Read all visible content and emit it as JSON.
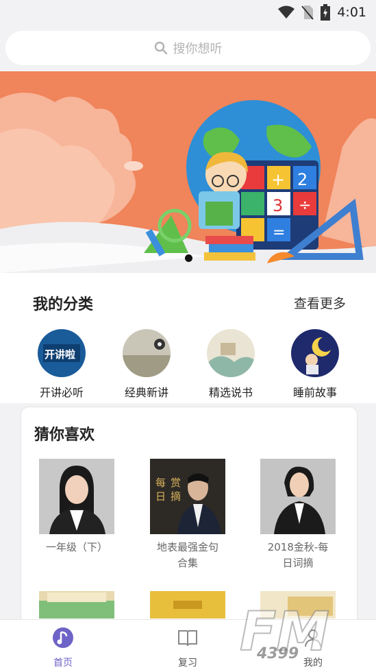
{
  "status": {
    "time": "4:01",
    "icons": [
      "wifi-icon",
      "no-sim-icon",
      "battery-charging-icon"
    ]
  },
  "search": {
    "placeholder": "搜你想听",
    "icon": "search-icon"
  },
  "banner": {
    "active_index": 0,
    "dots": 1
  },
  "categories": {
    "title": "我的分类",
    "more": "查看更多",
    "items": [
      {
        "label": "开讲必听",
        "icon": "kaijiang-thumb"
      },
      {
        "label": "经典新讲",
        "icon": "classic-thumb"
      },
      {
        "label": "精选说书",
        "icon": "storybook-thumb"
      },
      {
        "label": "睡前故事",
        "icon": "bedtime-thumb"
      }
    ]
  },
  "recommend": {
    "title": "猜你喜欢",
    "items": [
      {
        "line1": "一年级（下）",
        "line2": ""
      },
      {
        "line1": "地表最强金句",
        "line2": "合集"
      },
      {
        "line1": "2018金秋-每",
        "line2": "日词摘"
      }
    ],
    "thumb_texts": [
      "每",
      "日",
      "赏",
      "摘"
    ]
  },
  "tabs": [
    {
      "label": "首页",
      "active": true,
      "icon": "music-note-icon"
    },
    {
      "label": "复习",
      "active": false,
      "icon": "book-icon"
    },
    {
      "label": "我的",
      "active": false,
      "icon": "user-icon"
    }
  ],
  "colors": {
    "accent": "#6e63c6",
    "banner": "#f0845a"
  }
}
